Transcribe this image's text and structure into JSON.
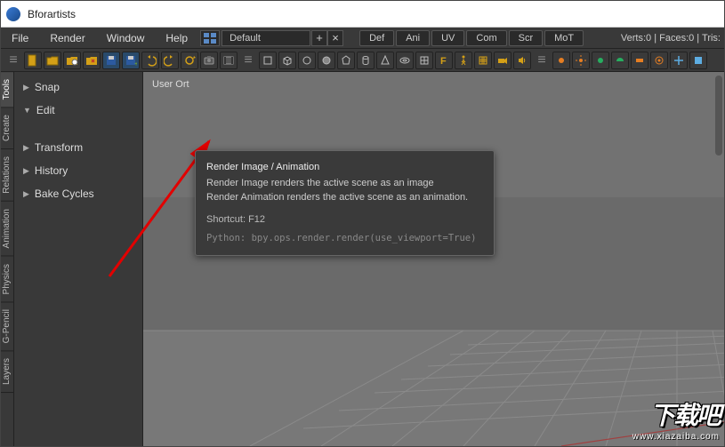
{
  "title": "Bforartists",
  "menu": [
    "File",
    "Render",
    "Window",
    "Help"
  ],
  "layout_dropdown": "Default",
  "header_tabs": [
    "Def",
    "Ani",
    "UV",
    "Com",
    "Scr",
    "MoT"
  ],
  "stats": "Verts:0 | Faces:0 | Tris:",
  "vtabs": [
    "Tools",
    "Create",
    "Relations",
    "Animation",
    "Physics",
    "G-Pencil",
    "Layers"
  ],
  "side_panels": [
    "Snap",
    "Edit",
    "Transform",
    "History",
    "Bake Cycles"
  ],
  "viewport_label": "User Ort",
  "tooltip": {
    "title": "Render Image / Animation",
    "line1": "Render Image renders the active scene as an image",
    "line2": "Render Animation renders the active scene as an animation.",
    "shortcut": "Shortcut: F12",
    "python": "Python: bpy.ops.render.render(use_viewport=True)"
  },
  "watermark": {
    "big": "下载吧",
    "url": "www.xiazaiba.com"
  }
}
